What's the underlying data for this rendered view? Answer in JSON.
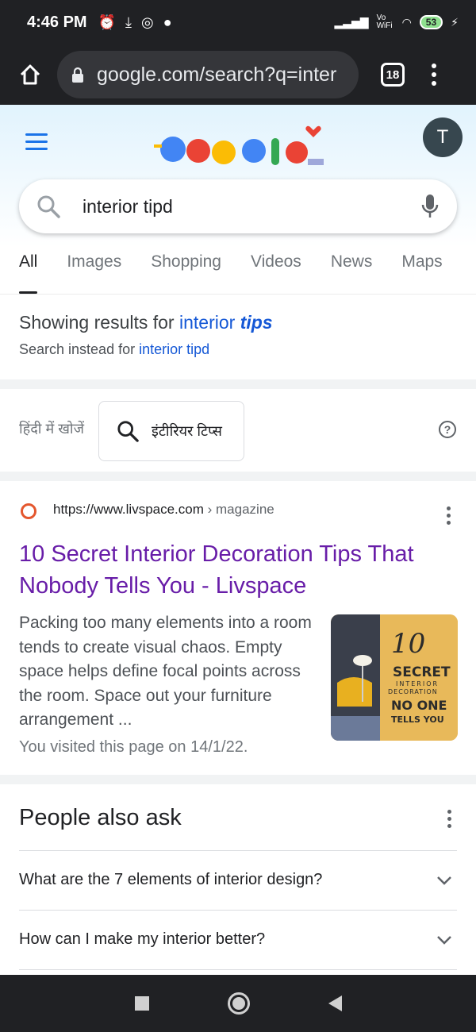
{
  "status_bar": {
    "time": "4:46 PM",
    "network_label": "Vo WiFi",
    "battery": "53"
  },
  "browser": {
    "url": "google.com/search?q=inter",
    "tab_count": "18"
  },
  "header": {
    "avatar_letter": "T",
    "query": "interior tipd"
  },
  "tabs": [
    "All",
    "Images",
    "Shopping",
    "Videos",
    "News",
    "Maps"
  ],
  "correction": {
    "showing_prefix": "Showing results for",
    "corrected_word1": "interior",
    "corrected_word2": "tips",
    "instead_prefix": "Search instead for",
    "original_query": "interior tipd"
  },
  "hindi": {
    "label": "हिंदी में खोजें",
    "chip_query": "इंटीरियर टिप्स"
  },
  "result": {
    "url": "https://www.livspace.com",
    "breadcrumb": " › magazine",
    "title": "10 Secret Interior Decoration Tips That Nobody Tells You - Livspace",
    "snippet": "Packing too many elements into a room tends to create visual chaos. Empty space helps define focal points across the room. Space out your furniture arrangement ...",
    "visited": "You visited this page on 14/1/22.",
    "thumb": {
      "number": "10",
      "secret": "SECRET",
      "line2": "INTERIOR",
      "line3": "DECORATION",
      "no_one": "NO ONE",
      "tells": "TELLS YOU"
    }
  },
  "paa": {
    "title": "People also ask",
    "questions": [
      "What are the 7 elements of interior design?",
      "How can I make my interior better?"
    ]
  },
  "colors": {
    "link": "#1558d6",
    "visited": "#681da8",
    "dark_bar": "#202124"
  }
}
